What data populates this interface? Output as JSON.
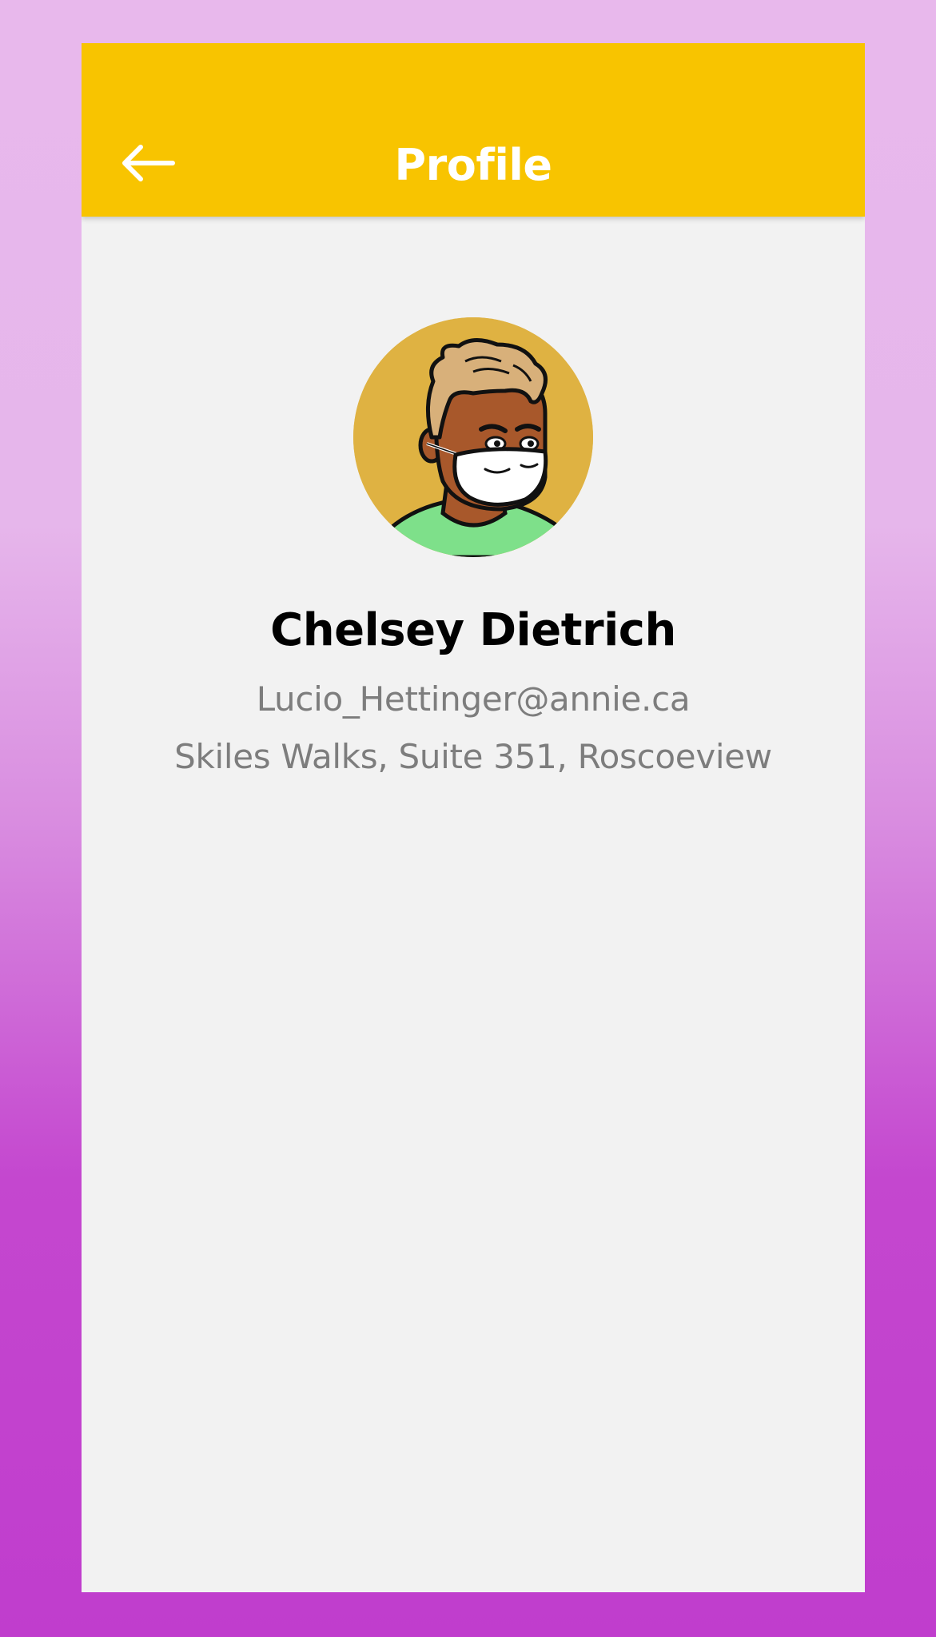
{
  "app_bar": {
    "title": "Profile",
    "background_color": "#f8c400",
    "back_icon": "arrow-left-icon"
  },
  "profile": {
    "avatar_icon": "avatar-illustration-masked-person",
    "name": "Chelsey Dietrich",
    "email": "Lucio_Hettinger@annie.ca",
    "address": "Skiles Walks, Suite 351, Roscoeview"
  }
}
